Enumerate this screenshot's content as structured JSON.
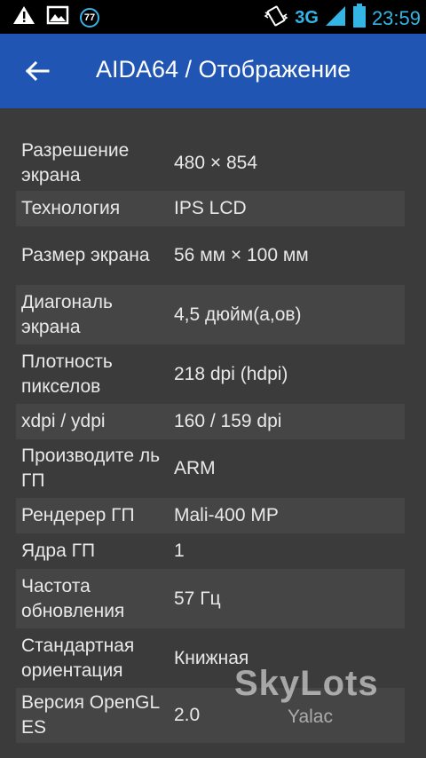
{
  "status_bar": {
    "notification_count": "77",
    "network_type": "3G",
    "time": "23:59"
  },
  "app_bar": {
    "title": "AIDA64  /  Отображение"
  },
  "rows": [
    {
      "label": "Разрешение экрана",
      "value": "480 × 854"
    },
    {
      "label": "Технология",
      "value": "IPS LCD"
    },
    {
      "label": "Размер экрана",
      "value": "56 мм × 100 мм"
    },
    {
      "label": "Диагональ экрана",
      "value": "4,5 дюйм(а,ов)"
    },
    {
      "label": "Плотность пикселов",
      "value": "218 dpi (hdpi)"
    },
    {
      "label": "xdpi / ydpi",
      "value": "160 / 159 dpi"
    },
    {
      "label": "Производите ль ГП",
      "value": "ARM"
    },
    {
      "label": "Рендерер ГП",
      "value": "Mali-400 MP"
    },
    {
      "label": "Ядра ГП",
      "value": "1"
    },
    {
      "label": "Частота обновления",
      "value": "57 Гц"
    },
    {
      "label": "Стандартная ориентация",
      "value": "Книжная"
    },
    {
      "label": "Версия OpenGL ES",
      "value": "2.0"
    }
  ],
  "watermark": {
    "main": "SkyLots",
    "sub": "Yalac"
  },
  "colors": {
    "app_bar": "#2155b4",
    "accent": "#33b5e5",
    "background": "#3b3b3b",
    "row_alt": "#454545"
  }
}
